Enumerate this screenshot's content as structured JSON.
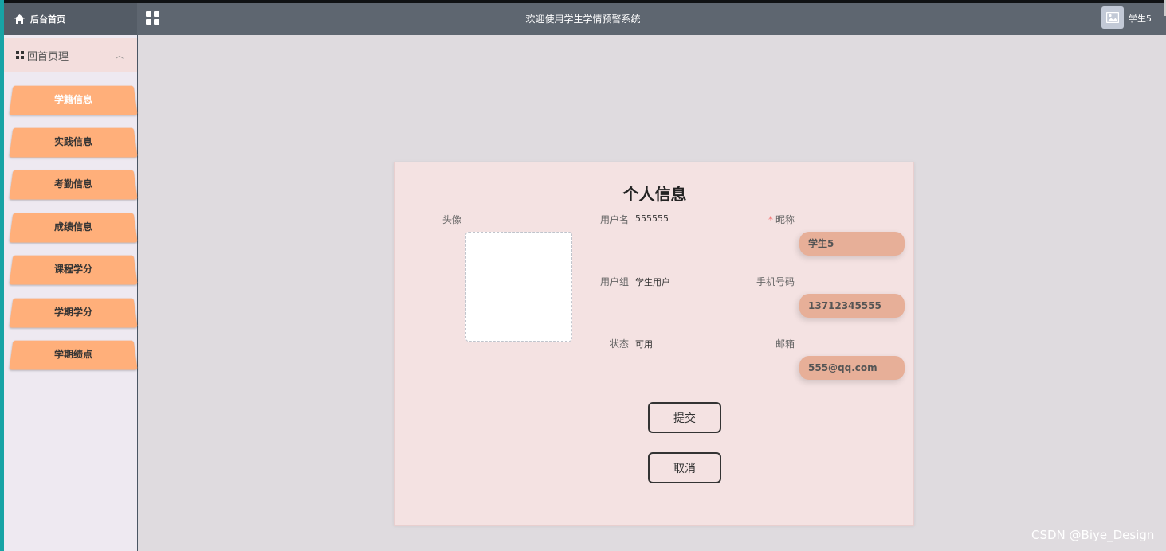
{
  "header": {
    "home_label": "后台首页",
    "title": "欢迎使用学生学情预警系统",
    "user": "学生5"
  },
  "sidebar": {
    "section_label": "回首页理",
    "items": [
      {
        "label": "学籍信息",
        "active": true
      },
      {
        "label": "实践信息"
      },
      {
        "label": "考勤信息"
      },
      {
        "label": "成绩信息"
      },
      {
        "label": "课程学分"
      },
      {
        "label": "学期学分"
      },
      {
        "label": "学期绩点"
      }
    ]
  },
  "profile": {
    "title": "个人信息",
    "avatar_label": "头像",
    "username_label": "用户名",
    "username": "555555",
    "group_label": "用户组",
    "group": "学生用户",
    "status_label": "状态",
    "status": "可用",
    "nickname_label": "昵称",
    "nickname": "学生5",
    "phone_label": "手机号码",
    "phone": "13712345555",
    "email_label": "邮箱",
    "email": "555@qq.com",
    "submit_label": "提交",
    "cancel_label": "取消"
  },
  "watermark": "CSDN @Biye_Design",
  "colors": {
    "topbar": "#5e6670",
    "sidebar_bg": "#eee9f1",
    "menu_item": "#ffaf7a",
    "card_bg": "#f4e2e2",
    "field_bg": "#e7af98",
    "accent_edge": "#17a3a5"
  }
}
